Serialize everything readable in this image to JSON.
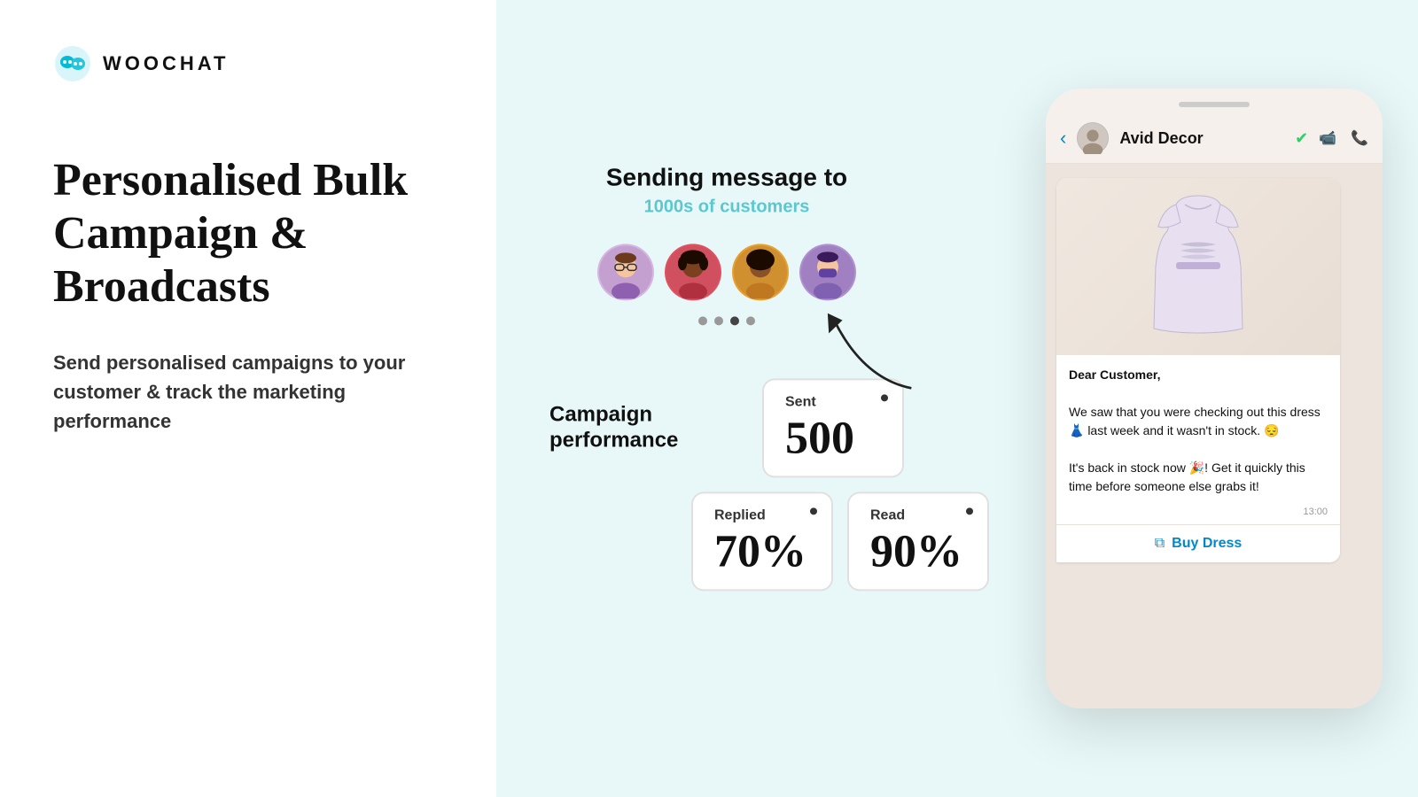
{
  "logo": {
    "text": "WOOCHAT"
  },
  "left": {
    "heading": "Personalised Bulk Campaign & Broadcasts",
    "subtext": "Send personalised campaigns to your customer & track the marketing performance"
  },
  "campaign": {
    "sending_title": "Sending message to",
    "sending_subtitle": "1000s of customers",
    "avatars": [
      "👩‍🦱",
      "👩‍🦱",
      "👱",
      "👩"
    ],
    "dots": [
      false,
      false,
      true,
      false
    ],
    "performance_label": "Campaign performance",
    "stats": [
      {
        "label": "Sent",
        "value": "500",
        "id": "sent"
      },
      {
        "label": "Replied",
        "value": "70%",
        "id": "replied"
      },
      {
        "label": "Read",
        "value": "90%",
        "id": "read"
      }
    ]
  },
  "phone": {
    "contact_name": "Avid Decor",
    "message_text_1": "Dear Customer,",
    "message_text_2": "We saw that you were checking out this dress 👗 last week and it wasn't in stock. 😔",
    "message_text_3": "It's back in stock now 🎉! Get it quickly this time before someone else grabs it!",
    "message_time": "13:00",
    "buy_button_label": "Buy Dress"
  }
}
